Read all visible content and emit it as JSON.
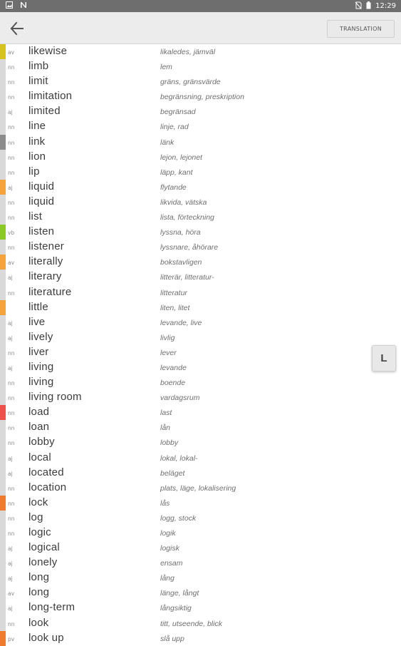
{
  "status_bar": {
    "time": "12:29",
    "left_icons": [
      "image-icon",
      "notification-n-icon"
    ],
    "right_icons": [
      "no-sim-icon",
      "battery-icon"
    ]
  },
  "header": {
    "back_icon": "back-arrow-icon",
    "translation_button_label": "TRANSLATION"
  },
  "index_letter": "L",
  "colors": {
    "accent_yellow": "#d6c31e",
    "accent_orange": "#f5a33a",
    "accent_green": "#8ac926",
    "accent_red": "#f0504a",
    "accent_deep_orange": "#f07b2f",
    "accent_gray": "#8c8c8c",
    "default": "#d9d9d9"
  },
  "words": [
    {
      "pos": "av",
      "word": "likewise",
      "translation": "likaledes, jämväl",
      "color": "#d6c31e"
    },
    {
      "pos": "nn",
      "word": "limb",
      "translation": "lem",
      "color": "#d9d9d9"
    },
    {
      "pos": "nn",
      "word": "limit",
      "translation": "gräns, gränsvärde",
      "color": "#d9d9d9"
    },
    {
      "pos": "nn",
      "word": "limitation",
      "translation": "begränsning, preskription",
      "color": "#d9d9d9"
    },
    {
      "pos": "aj",
      "word": "limited",
      "translation": "begränsad",
      "color": "#d9d9d9"
    },
    {
      "pos": "nn",
      "word": "line",
      "translation": "linje, rad",
      "color": "#d9d9d9"
    },
    {
      "pos": "nn",
      "word": "link",
      "translation": "länk",
      "color": "#8c8c8c"
    },
    {
      "pos": "nn",
      "word": "lion",
      "translation": "lejon, lejonet",
      "color": "#d9d9d9"
    },
    {
      "pos": "nn",
      "word": "lip",
      "translation": "läpp, kant",
      "color": "#d9d9d9"
    },
    {
      "pos": "aj",
      "word": "liquid",
      "translation": "flytande",
      "color": "#f5a33a"
    },
    {
      "pos": "nn",
      "word": "liquid",
      "translation": "likvida, vätska",
      "color": "#d9d9d9"
    },
    {
      "pos": "nn",
      "word": "list",
      "translation": "lista, förteckning",
      "color": "#d9d9d9"
    },
    {
      "pos": "vb",
      "word": "listen",
      "translation": "lyssna, höra",
      "color": "#8ac926"
    },
    {
      "pos": "nn",
      "word": "listener",
      "translation": "lyssnare, åhörare",
      "color": "#d9d9d9"
    },
    {
      "pos": "av",
      "word": "literally",
      "translation": "bokstavligen",
      "color": "#f5a33a"
    },
    {
      "pos": "aj",
      "word": "literary",
      "translation": "litterär, litteratur-",
      "color": "#d9d9d9"
    },
    {
      "pos": "nn",
      "word": "literature",
      "translation": "litteratur",
      "color": "#d9d9d9"
    },
    {
      "pos": "",
      "word": "little",
      "translation": "liten, litet",
      "color": "#f5a33a"
    },
    {
      "pos": "aj",
      "word": "live",
      "translation": "levande, live",
      "color": "#d9d9d9"
    },
    {
      "pos": "aj",
      "word": "lively",
      "translation": "livlig",
      "color": "#d9d9d9"
    },
    {
      "pos": "nn",
      "word": "liver",
      "translation": "lever",
      "color": "#d9d9d9"
    },
    {
      "pos": "aj",
      "word": "living",
      "translation": "levande",
      "color": "#d9d9d9"
    },
    {
      "pos": "nn",
      "word": "living",
      "translation": "boende",
      "color": "#d9d9d9"
    },
    {
      "pos": "nn",
      "word": "living room",
      "translation": "vardagsrum",
      "color": "#d9d9d9"
    },
    {
      "pos": "nn",
      "word": "load",
      "translation": "last",
      "color": "#f0504a"
    },
    {
      "pos": "nn",
      "word": "loan",
      "translation": "lån",
      "color": "#d9d9d9"
    },
    {
      "pos": "nn",
      "word": "lobby",
      "translation": "lobby",
      "color": "#d9d9d9"
    },
    {
      "pos": "aj",
      "word": "local",
      "translation": "lokal, lokal-",
      "color": "#d9d9d9"
    },
    {
      "pos": "aj",
      "word": "located",
      "translation": "beläget",
      "color": "#d9d9d9"
    },
    {
      "pos": "nn",
      "word": "location",
      "translation": "plats, läge, lokalisering",
      "color": "#d9d9d9"
    },
    {
      "pos": "nn",
      "word": "lock",
      "translation": "lås",
      "color": "#f07b2f"
    },
    {
      "pos": "nn",
      "word": "log",
      "translation": "logg, stock",
      "color": "#d9d9d9"
    },
    {
      "pos": "nn",
      "word": "logic",
      "translation": "logik",
      "color": "#d9d9d9"
    },
    {
      "pos": "aj",
      "word": "logical",
      "translation": "logisk",
      "color": "#d9d9d9"
    },
    {
      "pos": "aj",
      "word": "lonely",
      "translation": "ensam",
      "color": "#d9d9d9"
    },
    {
      "pos": "aj",
      "word": "long",
      "translation": "lång",
      "color": "#d9d9d9"
    },
    {
      "pos": "av",
      "word": "long",
      "translation": "länge, långt",
      "color": "#d9d9d9"
    },
    {
      "pos": "aj",
      "word": "long-term",
      "translation": "långsiktig",
      "color": "#d9d9d9"
    },
    {
      "pos": "nn",
      "word": "look",
      "translation": "titt, utseende, blick",
      "color": "#d9d9d9"
    },
    {
      "pos": "pv",
      "word": "look up",
      "translation": "slå upp",
      "color": "#f07b2f"
    }
  ]
}
